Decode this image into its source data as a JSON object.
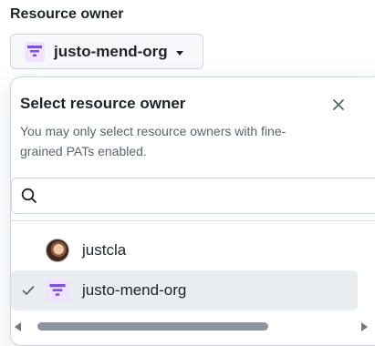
{
  "field_label": "Resource owner",
  "owner_button": {
    "selected_label": "justo-mend-org",
    "icon": "org-avatar-icon",
    "caret_icon": "caret-down-icon"
  },
  "popover": {
    "title": "Select resource owner",
    "close_icon": "close-icon",
    "description": "You may only select resource owners with fine-grained PATs enabled.",
    "search": {
      "placeholder": "",
      "value": "",
      "icon": "search-icon"
    },
    "items": [
      {
        "label": "justcla",
        "avatar": "user-avatar",
        "selected": false
      },
      {
        "label": "justo-mend-org",
        "avatar": "org-avatar-icon",
        "selected": true
      }
    ]
  },
  "colors": {
    "org_avatar_fg": "#8250df",
    "org_avatar_bg": "#efe3ff",
    "selected_row_bg": "#eaedf0",
    "border": "#d0d7de"
  }
}
